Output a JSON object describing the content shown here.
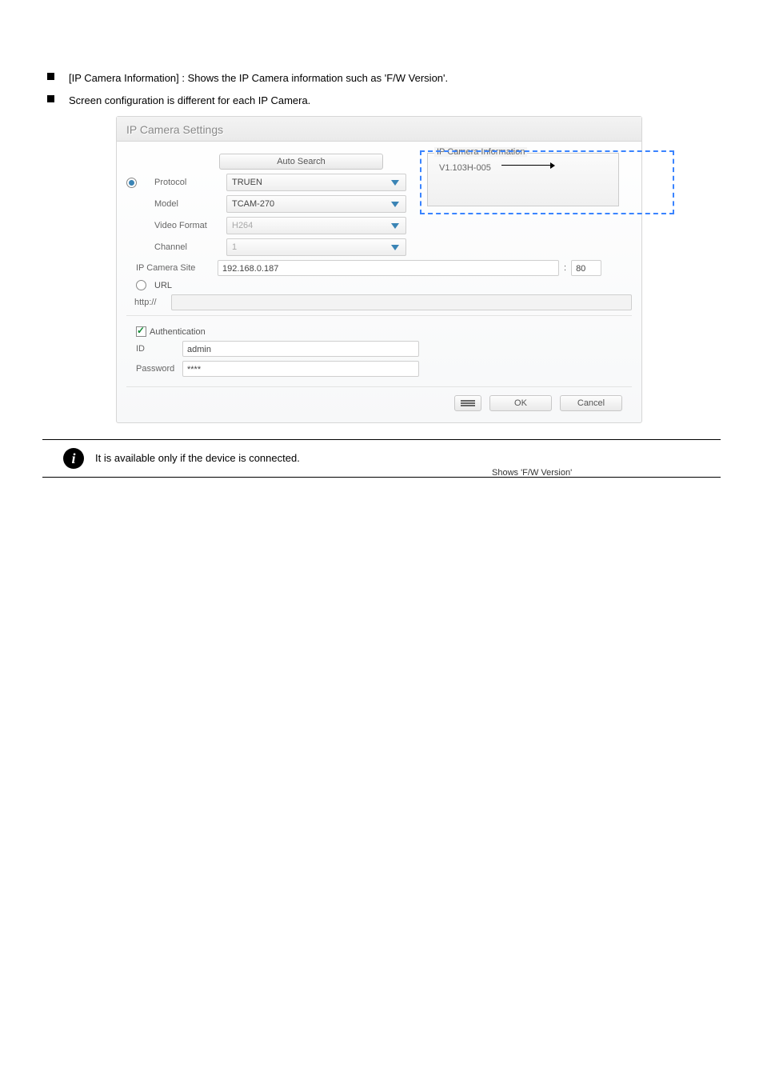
{
  "bullets": {
    "line1": "[IP Camera Information] : Shows the IP Camera information such as 'F/W Version'.",
    "line2": "Screen configuration is different for each IP Camera."
  },
  "panel": {
    "title": "IP Camera Settings",
    "auto_search": "Auto Search",
    "info_legend": "IP Camera Information",
    "fw_version": "V1.103H-005",
    "fields": {
      "protocol_label": "Protocol",
      "protocol_value": "TRUEN",
      "model_label": "Model",
      "model_value": "TCAM-270",
      "vformat_label": "Video Format",
      "vformat_value": "H264",
      "channel_label": "Channel",
      "channel_value": "1",
      "site_label": "IP Camera Site",
      "site_value": "192.168.0.187",
      "port_value": "80",
      "url_radio": "URL",
      "http_label": "http://",
      "http_value": "",
      "auth_chk": "Authentication",
      "id_label": "ID",
      "id_value": "admin",
      "pw_label": "Password",
      "pw_value": "****"
    },
    "buttons": {
      "ok": "OK",
      "cancel": "Cancel"
    }
  },
  "callout": "Shows 'F/W Version'",
  "note": "It is available only if the device is connected."
}
